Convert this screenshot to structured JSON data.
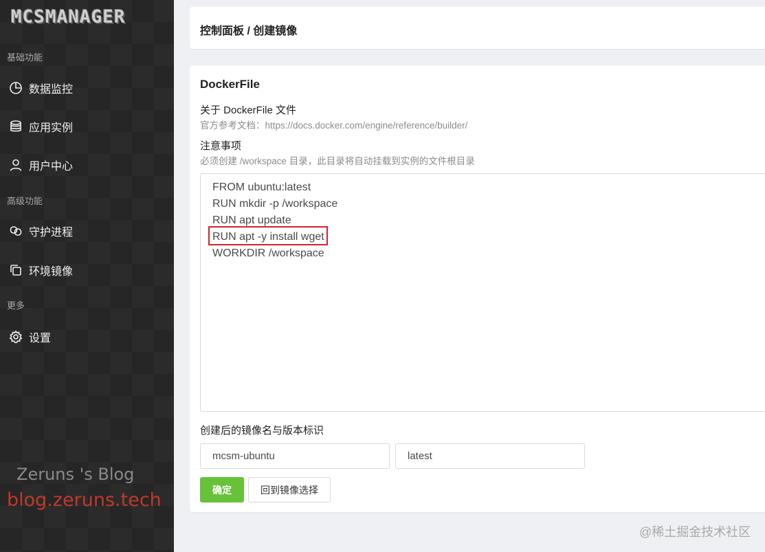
{
  "sidebar": {
    "logo": "MCSMANAGER",
    "sections": [
      {
        "label": "基础功能",
        "items": [
          {
            "icon": "pie-chart-icon",
            "label": "数据监控"
          },
          {
            "icon": "database-icon",
            "label": "应用实例"
          },
          {
            "icon": "user-icon",
            "label": "用户中心"
          }
        ]
      },
      {
        "label": "高级功能",
        "items": [
          {
            "icon": "link-icon",
            "label": "守护进程"
          },
          {
            "icon": "copy-icon",
            "label": "环境镜像"
          }
        ]
      },
      {
        "label": "更多",
        "items": [
          {
            "icon": "gear-icon",
            "label": "设置"
          }
        ]
      }
    ],
    "watermark_title": "Zeruns 's Blog",
    "watermark_link": "blog.zeruns.tech"
  },
  "header": {
    "breadcrumb": "控制面板 / 创建镜像"
  },
  "main": {
    "card_title": "DockerFile",
    "about_title": "关于 DockerFile 文件",
    "about_desc": "官方参考文档：https://docs.docker.com/engine/reference/builder/",
    "notice_title": "注意事项",
    "notice_desc": "必须创建 /workspace 目录，此目录将自动挂载到实例的文件根目录",
    "dockerfile_lines": [
      "FROM ubuntu:latest",
      "RUN mkdir -p /workspace",
      "RUN apt update",
      "RUN apt -y install wget",
      "WORKDIR /workspace"
    ],
    "image_name_label": "创建后的镜像名与版本标识",
    "image_name_value": "mcsm-ubuntu",
    "image_version_value": "latest",
    "confirm_label": "确定",
    "back_label": "回到镜像选择"
  },
  "site_watermark": "@稀土掘金技术社区",
  "colors": {
    "accent_green": "#67c23a",
    "highlight_red": "#d0232b",
    "sidebar_bg": "#262626"
  }
}
